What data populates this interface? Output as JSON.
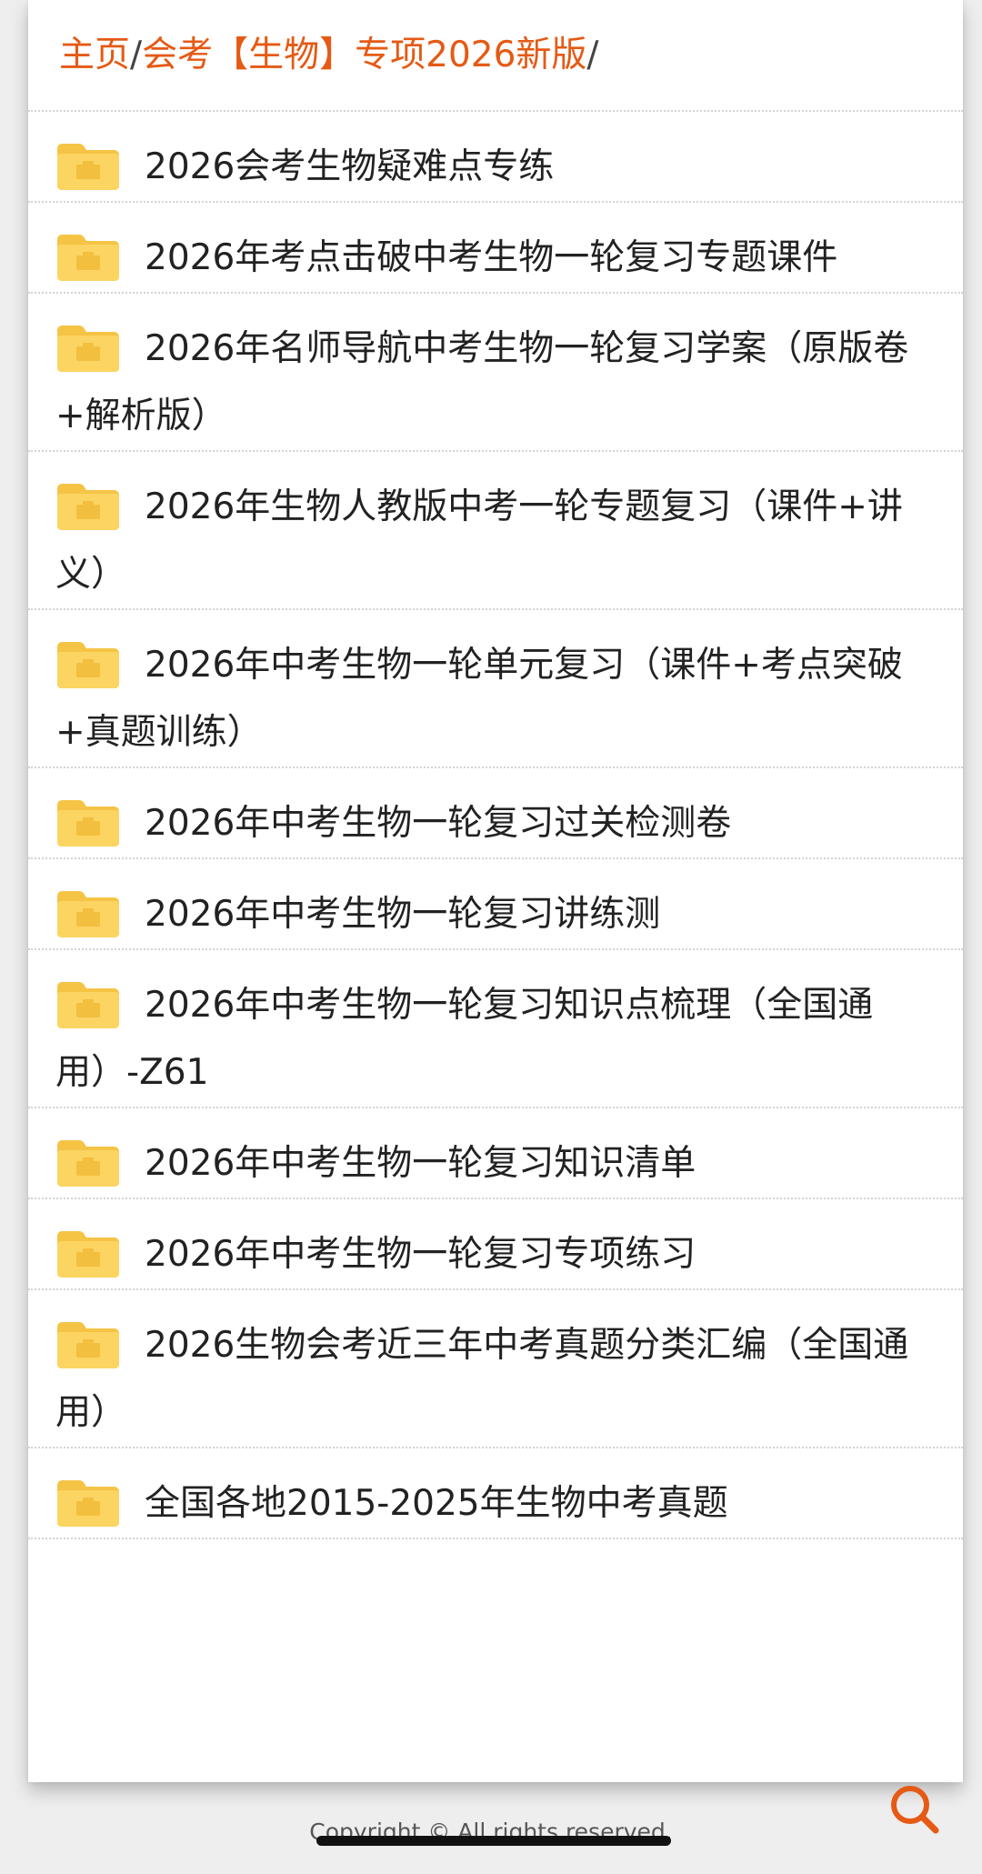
{
  "breadcrumb": {
    "home": "主页",
    "separator": "/",
    "current": "会考【生物】专项2026新版",
    "trailing": "/"
  },
  "folders": [
    {
      "label": "2026会考生物疑难点专练"
    },
    {
      "label": "2026年考点击破中考生物一轮复习专题课件"
    },
    {
      "label": "2026年名师导航中考生物一轮复习学案（原版卷+解析版）"
    },
    {
      "label": "2026年生物人教版中考一轮专题复习（课件+讲义）"
    },
    {
      "label": "2026年中考生物一轮单元复习（课件+考点突破+真题训练）"
    },
    {
      "label": "2026年中考生物一轮复习过关检测卷"
    },
    {
      "label": "2026年中考生物一轮复习讲练测"
    },
    {
      "label": "2026年中考生物一轮复习知识点梳理（全国通用）-Z61"
    },
    {
      "label": "2026年中考生物一轮复习知识清单"
    },
    {
      "label": "2026年中考生物一轮复习专项练习"
    },
    {
      "label": "2026生物会考近三年中考真题分类汇编（全国通用）"
    },
    {
      "label": "全国各地2015-2025年生物中考真题"
    }
  ],
  "footer": {
    "copyright": "Copyright © All rights reserved."
  },
  "icons": {
    "folder": "folder-icon",
    "search": "search-icon"
  },
  "colors": {
    "accent": "#e55a14",
    "folder": "#fcd462"
  }
}
